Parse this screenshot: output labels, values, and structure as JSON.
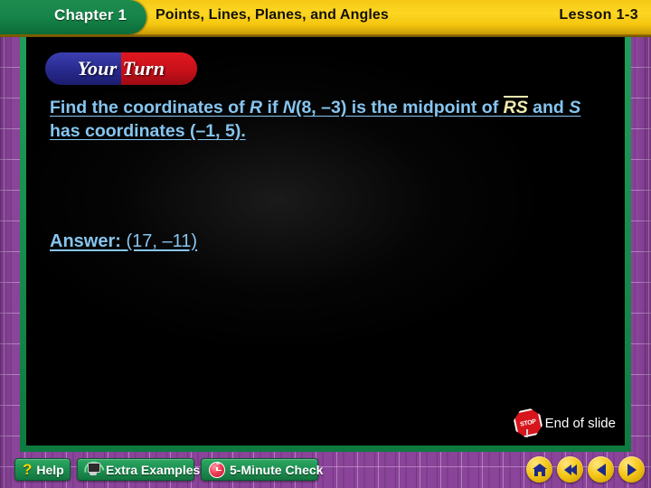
{
  "header": {
    "chapter_tab": "Chapter 1",
    "title": "Points, Lines, Planes, and Angles",
    "lesson": "Lesson 1-3"
  },
  "banner": {
    "label": "Your Turn"
  },
  "question": {
    "part1": "Find the coordinates of ",
    "var_r": "R",
    "part2": " if ",
    "var_n": "N",
    "part3": "(8, –3) is the midpoint of ",
    "segment_rs": "RS",
    "part4": " and ",
    "var_s": "S",
    "part5": " has coordinates (–1, 5)."
  },
  "answer": {
    "label": "Answer:",
    "value": "(17, –11)"
  },
  "end_of_slide": {
    "sign_text": "STOP",
    "label": "End of slide"
  },
  "toolbar": {
    "help": "Help",
    "help_icon_glyph": "?",
    "extra_examples": "Extra Examples",
    "five_minute_check": "5-Minute Check"
  },
  "navigation": {
    "home": "home",
    "rewind": "rewind",
    "previous": "previous",
    "next": "next"
  },
  "colors": {
    "header_gold": "#fdd723",
    "chapter_green": "#17864a",
    "frame_green": "#1f9e59",
    "border_purple": "#8a4499",
    "text_blue": "#86c5f0",
    "segment_yellow": "#f2edb0",
    "banner_blue": "#282a8e",
    "banner_red": "#c8101a",
    "button_green": "#1f9454",
    "nav_yellow": "#f6c818",
    "stop_red": "#d6151c"
  }
}
